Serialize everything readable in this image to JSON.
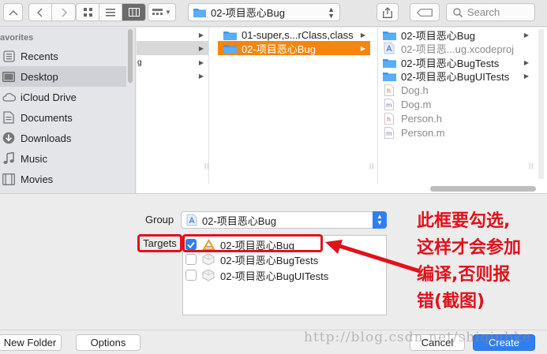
{
  "toolbar": {
    "back_icon": "chevron-left-icon",
    "forward_icon": "chevron-right-icon",
    "path_label": "02-项目恶心Bug",
    "search_placeholder": "Search"
  },
  "sidebar": {
    "heading": "avorites",
    "items": [
      {
        "label": "Recents",
        "icon": "recents-icon",
        "selected": false
      },
      {
        "label": "Desktop",
        "icon": "desktop-icon",
        "selected": true
      },
      {
        "label": "iCloud Drive",
        "icon": "cloud-icon",
        "selected": false
      },
      {
        "label": "Documents",
        "icon": "documents-icon",
        "selected": false
      },
      {
        "label": "Downloads",
        "icon": "downloads-icon",
        "selected": false
      },
      {
        "label": "Music",
        "icon": "music-icon",
        "selected": false
      },
      {
        "label": "Movies",
        "icon": "movies-icon",
        "selected": false
      }
    ]
  },
  "browser": {
    "col1_partial_label": "g",
    "col2": [
      {
        "label": "01-super,s...rClass,class"
      },
      {
        "label": "02-项目恶心Bug",
        "selected": true
      }
    ],
    "col3": [
      {
        "label": "02-项目恶心Bug",
        "type": "folder"
      },
      {
        "label": "02-项目恶...ug.xcodeproj",
        "type": "xcodeproj"
      },
      {
        "label": "02-项目恶心BugTests",
        "type": "folder"
      },
      {
        "label": "02-项目恶心BugUITests",
        "type": "folder"
      },
      {
        "label": "Dog.h",
        "type": "h"
      },
      {
        "label": "Dog.m",
        "type": "m"
      },
      {
        "label": "Person.h",
        "type": "h"
      },
      {
        "label": "Person.m",
        "type": "m"
      }
    ]
  },
  "form": {
    "group_label": "Group",
    "group_value": "02-项目恶心Bug",
    "targets_label": "Targets",
    "targets": [
      {
        "label": "02-项目恶心Bug",
        "checked": true
      },
      {
        "label": "02-项目恶心BugTests",
        "checked": false
      },
      {
        "label": "02-项目恶心BugUITests",
        "checked": false
      }
    ]
  },
  "bottom": {
    "new_folder": "New Folder",
    "options": "Options",
    "cancel": "Cancel",
    "create": "Create"
  },
  "annotation": {
    "line1": "此框要勾选,",
    "line2": "这样才会参加",
    "line3": "编译,否则报",
    "line4": "错(截图)"
  },
  "watermark": "http://blog.csdn.net/shiqiubke",
  "colors": {
    "accent": "#2f7ff0",
    "selection": "#f5850f",
    "annotation_red": "#e0121b"
  }
}
